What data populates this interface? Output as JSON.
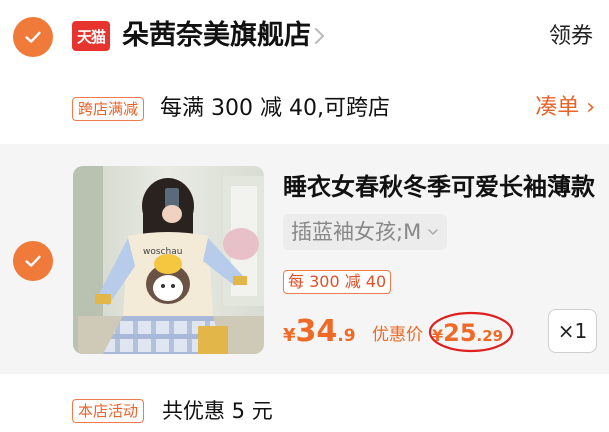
{
  "store": {
    "badge_text": "天猫",
    "name": "朵茜奈美旗舰店",
    "coupon_label": "领券",
    "checked": true
  },
  "promo": {
    "tag": "跨店满减",
    "text": "每满 300 减 40,可跨店",
    "action": "凑单 ›"
  },
  "item": {
    "checked": true,
    "title": "睡衣女春秋冬季可爱长袖薄款",
    "sku": "插蓝袖女孩;M",
    "discount_tag": "每 300 减 40",
    "price_symbol": "¥",
    "price_int": "34",
    "price_dec": ".9",
    "coupon_label": "优惠价",
    "coupon_symbol": "¥",
    "coupon_int": "25",
    "coupon_dec": ".29",
    "quantity": "×1"
  },
  "activity": {
    "tag": "本店活动",
    "text": "共优惠 5 元"
  },
  "colors": {
    "accent": "#f07a3a",
    "price": "#ef6a26",
    "tmall_red": "#e8342e",
    "highlight_ellipse": "#e02020"
  }
}
